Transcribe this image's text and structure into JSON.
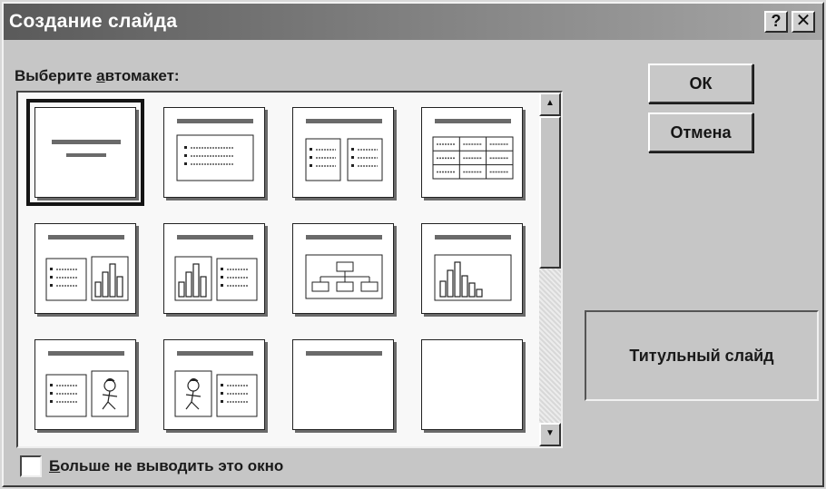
{
  "dialog": {
    "title": "Создание слайда",
    "help_glyph": "?",
    "close_glyph": "✕"
  },
  "autolayout": {
    "label_prefix": "Выберите ",
    "label_underlined": "а",
    "label_rest": "втомакет:",
    "layouts": [
      {
        "type": "title",
        "selected": true
      },
      {
        "type": "bulleted-list"
      },
      {
        "type": "two-column-text"
      },
      {
        "type": "table"
      },
      {
        "type": "text-and-chart"
      },
      {
        "type": "chart-and-text"
      },
      {
        "type": "org-chart"
      },
      {
        "type": "chart"
      },
      {
        "type": "text-and-clip-art"
      },
      {
        "type": "clip-art-and-text"
      },
      {
        "type": "title-only"
      },
      {
        "type": "blank"
      }
    ],
    "scroll_up_glyph": "▲",
    "scroll_down_glyph": "▼"
  },
  "buttons": {
    "ok": "ОК",
    "cancel": "Отмена"
  },
  "preview": {
    "caption": "Титульный слайд"
  },
  "dont_show": {
    "checked": false,
    "label_underlined": "Б",
    "label_rest": "ольше не выводить это окно"
  }
}
